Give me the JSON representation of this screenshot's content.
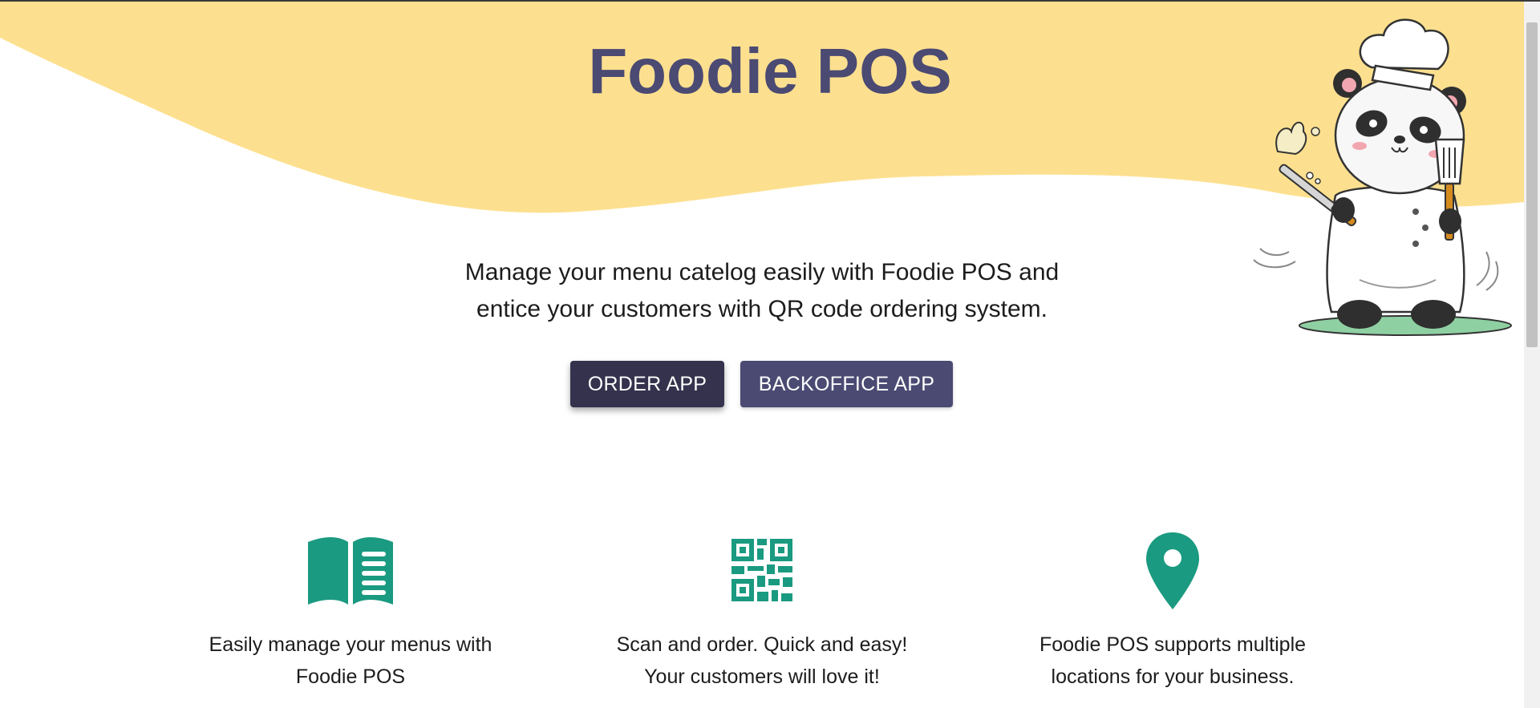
{
  "app": {
    "title": "Foodie POS"
  },
  "hero": {
    "tagline_line1": "Manage your menu catelog easily with Foodie POS and",
    "tagline_line2": "entice your customers with QR code ordering system.",
    "wave_color": "#fde08f",
    "title_color": "#4b4a73"
  },
  "buttons": {
    "order_app_label": "ORDER APP",
    "backoffice_app_label": "BACKOFFICE APP",
    "order_color": "#34324d",
    "backoffice_color": "#4b4a73"
  },
  "features": [
    {
      "icon": "menu-book-icon",
      "line1": "Easily manage your menus with",
      "line2": "Foodie POS"
    },
    {
      "icon": "qr-code-icon",
      "line1": "Scan and order. Quick and easy!",
      "line2": "Your customers will love it!"
    },
    {
      "icon": "location-pin-icon",
      "line1": "Foodie POS supports multiple",
      "line2": "locations for your business."
    }
  ],
  "theme": {
    "icon_color": "#1a9a80"
  }
}
